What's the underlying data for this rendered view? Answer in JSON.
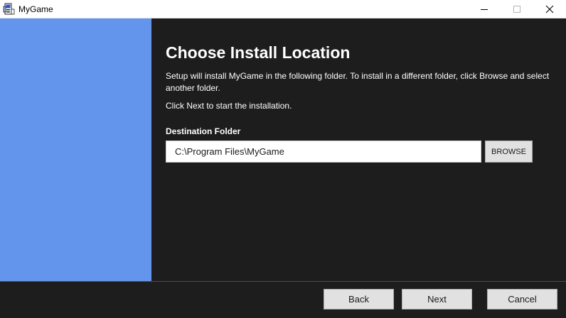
{
  "window": {
    "title": "MyGame",
    "icon": "installer-app-icon",
    "controls": {
      "minimize": "minimize-icon",
      "maximize": "maximize-icon",
      "close": "close-icon"
    }
  },
  "colors": {
    "sidebar": "#6495ed",
    "background": "#1d1d1d",
    "text": "#ffffff",
    "button": "#e1e1e1"
  },
  "page": {
    "heading": "Choose Install Location",
    "description": "Setup will install MyGame in the following folder. To install in a different folder, click Browse and select another folder.",
    "instruction": "Click Next to start the installation.",
    "destination_label": "Destination Folder",
    "destination_value": "C:\\Program Files\\MyGame",
    "browse_label": "BROWSE"
  },
  "footer": {
    "back_label": "Back",
    "next_label": "Next",
    "cancel_label": "Cancel"
  }
}
